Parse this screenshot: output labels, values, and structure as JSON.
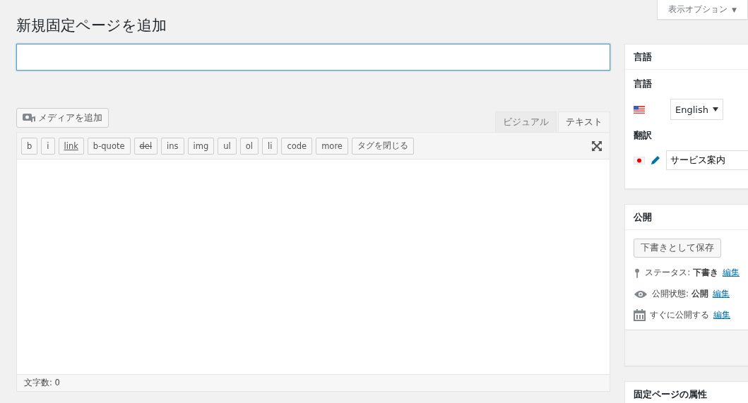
{
  "page_title": "新規固定ページを追加",
  "screen_options": {
    "label": "表示オプション",
    "caret": "▼"
  },
  "media_button": {
    "label": "メディアを追加"
  },
  "editor_tabs": [
    {
      "label": "ビジュアル",
      "selected": false
    },
    {
      "label": "テキスト",
      "selected": true
    }
  ],
  "quicktags": [
    {
      "label": "b",
      "kind": "plain"
    },
    {
      "label": "i",
      "kind": "plain"
    },
    {
      "label": "link",
      "kind": "link"
    },
    {
      "label": "b-quote",
      "kind": "plain"
    },
    {
      "label": "del",
      "kind": "strike"
    },
    {
      "label": "ins",
      "kind": "plain"
    },
    {
      "label": "img",
      "kind": "plain"
    },
    {
      "label": "ul",
      "kind": "plain"
    },
    {
      "label": "ol",
      "kind": "plain"
    },
    {
      "label": "li",
      "kind": "plain"
    },
    {
      "label": "code",
      "kind": "plain"
    },
    {
      "label": "more",
      "kind": "plain"
    },
    {
      "label": "タグを閉じる",
      "kind": "plain"
    }
  ],
  "word_count": "文字数: 0",
  "sidebar": {
    "language_panel": {
      "title": "言語",
      "language_label": "言語",
      "language_select": "English",
      "translation_label": "翻訳",
      "translation_value": "サービス案内"
    },
    "publish_panel": {
      "title": "公開",
      "save_draft": "下書きとして保存",
      "rows": [
        {
          "kind": "pin",
          "text": "ステータス: **下書き**",
          "link": "編集"
        },
        {
          "kind": "eye",
          "text": "公開状態: **公開**",
          "link": "編集"
        },
        {
          "kind": "calendar",
          "text": "すぐに公開する",
          "link": "編集"
        }
      ]
    },
    "attributes_panel": {
      "title": "固定ページの属性"
    }
  }
}
